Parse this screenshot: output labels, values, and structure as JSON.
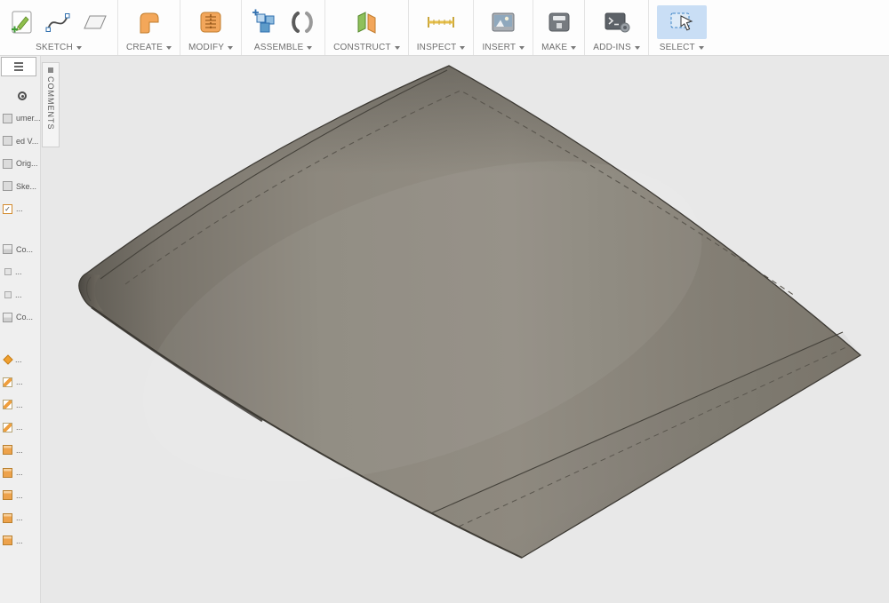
{
  "toolbar": {
    "groups": [
      {
        "label": "SKETCH",
        "icons": [
          "create-sketch-icon",
          "spline-icon",
          "sketch-plane-icon"
        ]
      },
      {
        "label": "CREATE",
        "icons": [
          "extrude-icon"
        ]
      },
      {
        "label": "MODIFY",
        "icons": [
          "press-pull-icon"
        ]
      },
      {
        "label": "ASSEMBLE",
        "icons": [
          "new-component-icon",
          "joint-icon"
        ]
      },
      {
        "label": "CONSTRUCT",
        "icons": [
          "construction-plane-icon"
        ]
      },
      {
        "label": "INSPECT",
        "icons": [
          "measure-icon"
        ]
      },
      {
        "label": "INSERT",
        "icons": [
          "insert-image-icon"
        ]
      },
      {
        "label": "MAKE",
        "icons": [
          "print-3d-icon"
        ]
      },
      {
        "label": "ADD-INS",
        "icons": [
          "scripts-addins-icon"
        ]
      },
      {
        "label": "SELECT",
        "icons": [
          "select-cursor-icon"
        ],
        "highlighted": true,
        "highlight_color": "#c9def5"
      }
    ]
  },
  "browser": {
    "comments_tab": {
      "label": "COMMENTS"
    },
    "items": [
      {
        "icon": "target-icon",
        "label": ""
      },
      {
        "icon": "document-icon",
        "label": "umer..."
      },
      {
        "icon": "named-views-icon",
        "label": "ed V..."
      },
      {
        "icon": "origin-icon",
        "label": "Orig..."
      },
      {
        "icon": "sketches-icon",
        "label": "Ske..."
      },
      {
        "icon": "checkbox-icon",
        "label": "..."
      },
      {
        "icon": "component-icon",
        "label": "Co..."
      },
      {
        "icon": "item-icon",
        "label": "..."
      },
      {
        "icon": "item-icon",
        "label": "..."
      },
      {
        "icon": "component-icon",
        "label": "Co..."
      },
      {
        "icon": "origin-point-icon",
        "label": "..."
      },
      {
        "icon": "sketch-icon",
        "label": "..."
      },
      {
        "icon": "sketch-icon",
        "label": "..."
      },
      {
        "icon": "sketch-icon",
        "label": "..."
      },
      {
        "icon": "body-icon",
        "label": "..."
      },
      {
        "icon": "body-icon",
        "label": "..."
      },
      {
        "icon": "body-icon",
        "label": "..."
      },
      {
        "icon": "body-icon",
        "label": "..."
      },
      {
        "icon": "body-icon",
        "label": "..."
      }
    ]
  },
  "viewport": {
    "background": "#e8e8e8",
    "model": "shaded swept wing surface with projected dashed sketch lines and trailing-edge flap lines"
  },
  "colors": {
    "wing_mid": "#8d887e",
    "wing_dark": "#635f57",
    "wing_edge": "#3d3a34",
    "toolbar_highlight": "#c9def5"
  }
}
